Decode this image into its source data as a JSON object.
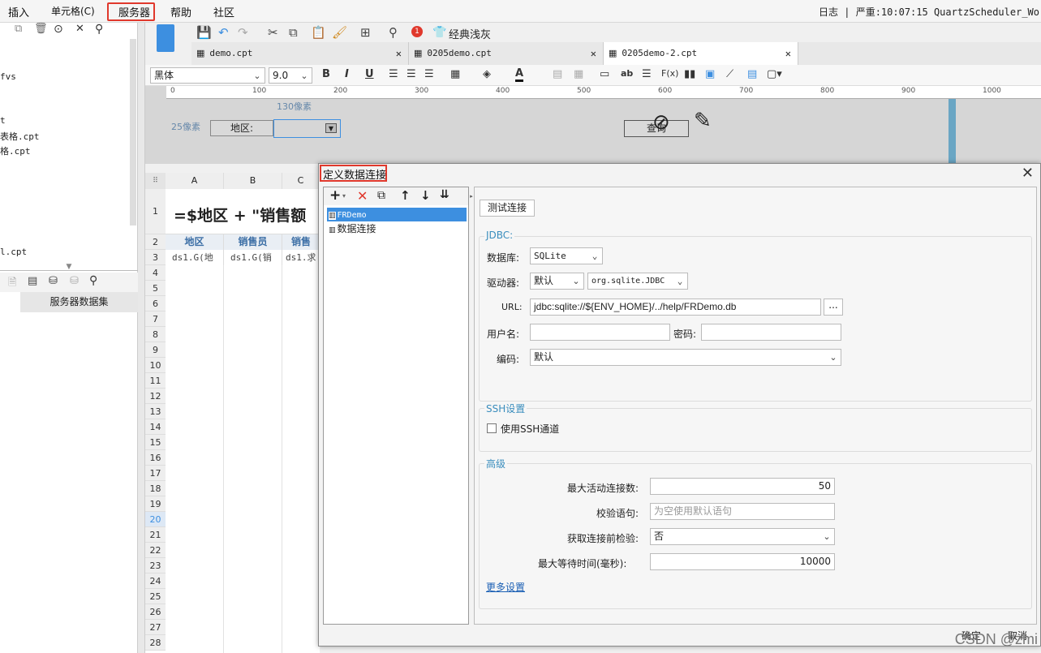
{
  "menu": {
    "items": [
      "插入",
      "单元格(C)",
      "服务器",
      "帮助",
      "社区"
    ],
    "status": "日志 | 严重:10:07:15 QuartzScheduler_Wo"
  },
  "left_panel": {
    "files": [
      "fvs",
      "t",
      "表格.cpt",
      "格.cpt",
      "l.cpt"
    ],
    "tab": "服务器数据集"
  },
  "toolbar": {
    "badge": "1",
    "theme_label": "经典浅灰"
  },
  "tabs": [
    {
      "label": "demo.cpt"
    },
    {
      "label": "0205demo.cpt"
    },
    {
      "label": "0205demo-2.cpt"
    }
  ],
  "format": {
    "font": "黑体",
    "size": "9.0"
  },
  "ruler": {
    "marks": [
      "100",
      "200",
      "300",
      "400",
      "500",
      "600",
      "700",
      "800",
      "900",
      "1000"
    ]
  },
  "canvas": {
    "width_label": "130像素",
    "height_label": "25像素",
    "area_label": "地区:",
    "query_button": "查询"
  },
  "sheet": {
    "columns": [
      "A",
      "B",
      "C"
    ],
    "rows": [
      "1",
      "2",
      "3",
      "4",
      "5",
      "6",
      "7",
      "8",
      "9",
      "10",
      "11",
      "12",
      "13",
      "14",
      "15",
      "16",
      "17",
      "18",
      "19",
      "20",
      "21",
      "22",
      "23",
      "24",
      "25",
      "26",
      "27",
      "28"
    ],
    "title_formula": "=$地区 + \"销售额",
    "headers": [
      "地区",
      "销售员",
      "销售"
    ],
    "row3": [
      "ds1.G(地",
      "ds1.G(销",
      "ds1.求"
    ]
  },
  "dialog": {
    "title": "定义数据连接",
    "connections": [
      "FRDemo",
      "数据连接"
    ],
    "test_button": "测试连接",
    "jdbc": {
      "section": "JDBC:",
      "db_label": "数据库:",
      "db_value": "SQLite",
      "driver_label": "驱动器:",
      "driver_mode": "默认",
      "driver_class": "org.sqlite.JDBC",
      "url_label": "URL:",
      "url_value": "jdbc:sqlite://${ENV_HOME}/../help/FRDemo.db",
      "url_more": "...",
      "user_label": "用户名:",
      "password_label": "密码:",
      "encoding_label": "编码:",
      "encoding_value": "默认"
    },
    "ssh": {
      "section": "SSH设置",
      "use_ssh": "使用SSH通道"
    },
    "advanced": {
      "section": "高级",
      "max_active_label": "最大活动连接数:",
      "max_active_value": "50",
      "validation_label": "校验语句:",
      "validation_placeholder": "为空使用默认语句",
      "test_before_label": "获取连接前检验:",
      "test_before_value": "否",
      "max_wait_label": "最大等待时间(毫秒):",
      "max_wait_value": "10000",
      "more_settings": "更多设置"
    },
    "ok": "确定",
    "cancel": "取消"
  },
  "watermark": "CSDN @zmi",
  "colors": {
    "highlight": "#e0382c",
    "selection": "#3d8fe0",
    "section": "#3a8dbd",
    "header_text": "#3b6ea5"
  }
}
